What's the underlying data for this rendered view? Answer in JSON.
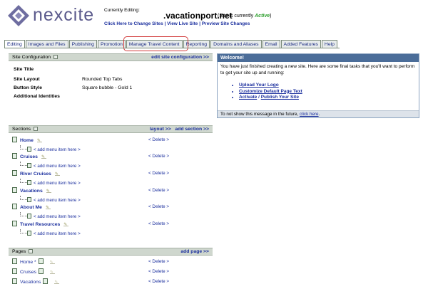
{
  "header": {
    "logo_text": "nexcite",
    "currently_editing_label": "Currently Editing:",
    "site_name": ".vacationport.net",
    "status_prefix": "(Site is currently ",
    "status_value": "Active",
    "status_suffix": ")",
    "links": {
      "change_sites": "Click Here to Change Sites",
      "view_live": "View Live Site",
      "preview": "Preview Site Changes",
      "sep": " | "
    }
  },
  "tabs": [
    "Editing",
    "Images and Files",
    "Publishing",
    "Promotion",
    "Manage Travel Content",
    "Reporting",
    "Domains and Aliases",
    "Email",
    "Added Features",
    "Help"
  ],
  "site_config": {
    "title": "Site Configuration",
    "action": "edit site configuration >>",
    "rows": [
      {
        "label": "Site Title",
        "value": ""
      },
      {
        "label": "Site Layout",
        "value": "Rounded Top Tabs"
      },
      {
        "label": "Button Style",
        "value": "Square bubble - Gold 1"
      },
      {
        "label": "Additional Identities",
        "value": ""
      }
    ]
  },
  "welcome": {
    "title": "Welcome!",
    "intro": "You have just finished creating a new site. Here are some final tasks that you'll want to perform to get your site up and running:",
    "tasks": [
      "Upload Your Logo",
      "Customize Default Page Text",
      "Activate",
      "Publish Your Site"
    ],
    "task_sep": " / ",
    "footer_text": "To not show this message in the future, ",
    "footer_link": "click here",
    "footer_end": "."
  },
  "sections": {
    "title": "Sections",
    "action_layout": "layout >>",
    "action_add": "add section >>",
    "delete_label": "< Delete >",
    "add_menu_label": "< add menu item here >",
    "items": [
      "Home",
      "Cruises",
      "River Cruises",
      "Vacations",
      "About Me",
      "Travel Resources"
    ]
  },
  "pages": {
    "title": "Pages",
    "action": "add page >>",
    "delete_label": "< Delete >",
    "items": [
      "Home *",
      "Cruises",
      "Vacations"
    ]
  },
  "colors": {
    "accent": "#1b2f9e",
    "panel_header": "#cfd7ce",
    "welcome_header": "#4b6d99",
    "highlight_ring": "#d23a3a",
    "active": "#2a9d2a"
  }
}
